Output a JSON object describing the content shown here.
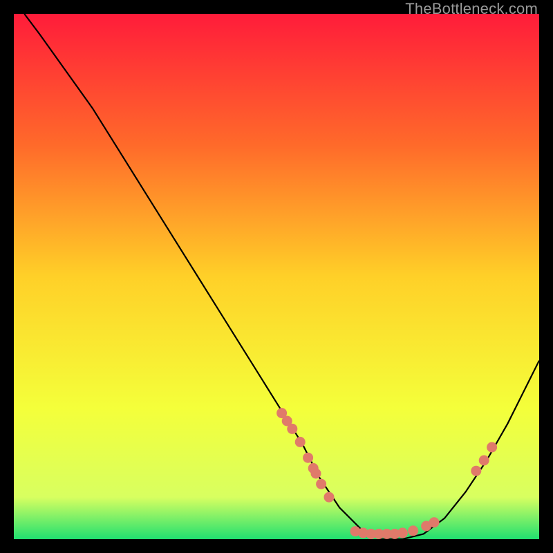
{
  "watermark": "TheBottleneck.com",
  "chart_data": {
    "type": "line",
    "title": "",
    "xlabel": "",
    "ylabel": "",
    "xlim": [
      0,
      100
    ],
    "ylim": [
      0,
      100
    ],
    "grid": false,
    "legend": false,
    "background_gradient": {
      "stops": [
        {
          "offset": 0,
          "color": "#ff1c3a"
        },
        {
          "offset": 25,
          "color": "#ff6a2a"
        },
        {
          "offset": 50,
          "color": "#ffd028"
        },
        {
          "offset": 75,
          "color": "#f4ff3a"
        },
        {
          "offset": 92,
          "color": "#d8ff60"
        },
        {
          "offset": 100,
          "color": "#20e070"
        }
      ]
    },
    "series": [
      {
        "name": "bottleneck-curve",
        "color": "#000000",
        "x": [
          2,
          5,
          10,
          15,
          20,
          25,
          30,
          35,
          40,
          45,
          50,
          55,
          58,
          62,
          66,
          70,
          74,
          78,
          82,
          86,
          90,
          94,
          98,
          100
        ],
        "y": [
          100,
          96,
          89,
          82,
          74,
          66,
          58,
          50,
          42,
          34,
          26,
          18,
          12,
          6,
          2,
          0,
          0,
          1,
          4,
          9,
          15,
          22,
          30,
          34
        ]
      }
    ],
    "markers": [
      {
        "name": "cluster-left-descent",
        "color": "#e07a6a",
        "points": [
          {
            "x": 51,
            "y": 24
          },
          {
            "x": 52,
            "y": 22.5
          },
          {
            "x": 53,
            "y": 21
          },
          {
            "x": 54.5,
            "y": 18.5
          },
          {
            "x": 56,
            "y": 15.5
          },
          {
            "x": 57,
            "y": 13.5
          },
          {
            "x": 57.5,
            "y": 12.5
          },
          {
            "x": 58.5,
            "y": 10.5
          },
          {
            "x": 60,
            "y": 8
          }
        ]
      },
      {
        "name": "cluster-valley",
        "color": "#e07a6a",
        "points": [
          {
            "x": 65,
            "y": 1.5
          },
          {
            "x": 66.5,
            "y": 1.2
          },
          {
            "x": 68,
            "y": 1
          },
          {
            "x": 69.5,
            "y": 1
          },
          {
            "x": 71,
            "y": 1
          },
          {
            "x": 72.5,
            "y": 1
          },
          {
            "x": 74,
            "y": 1.2
          },
          {
            "x": 76,
            "y": 1.6
          },
          {
            "x": 78.5,
            "y": 2.5
          },
          {
            "x": 80,
            "y": 3.2
          }
        ]
      },
      {
        "name": "cluster-right-ascent",
        "color": "#e07a6a",
        "points": [
          {
            "x": 88,
            "y": 13
          },
          {
            "x": 89.5,
            "y": 15
          },
          {
            "x": 91,
            "y": 17.5
          }
        ]
      }
    ]
  }
}
